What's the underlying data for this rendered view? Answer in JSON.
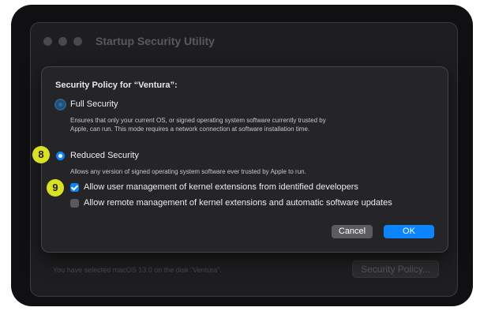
{
  "window": {
    "title": "Startup Security Utility",
    "footer_text": "You have selected macOS 13.0 on the disk “Ventura”.",
    "security_policy_button": "Security Policy..."
  },
  "sheet": {
    "title": "Security Policy for “Ventura”:",
    "full_security": {
      "label": "Full Security",
      "selected": false,
      "description_line1": "Ensures that only your current OS, or signed operating system software currently trusted by",
      "description_line2": "Apple, can run. This mode requires a network connection at software installation time."
    },
    "reduced_security": {
      "label": "Reduced Security",
      "selected": true,
      "description": "Allows any version of signed operating system software ever trusted by Apple to run."
    },
    "checkboxes": [
      {
        "label": "Allow user management of kernel extensions from identified developers",
        "checked": true
      },
      {
        "label": "Allow remote management of kernel extensions and automatic software updates",
        "checked": false
      }
    ],
    "cancel_label": "Cancel",
    "ok_label": "OK"
  },
  "markers": {
    "step_8": "8",
    "step_9": "9"
  },
  "colors": {
    "accent": "#0a84ff",
    "marker": "#d9e21f"
  }
}
